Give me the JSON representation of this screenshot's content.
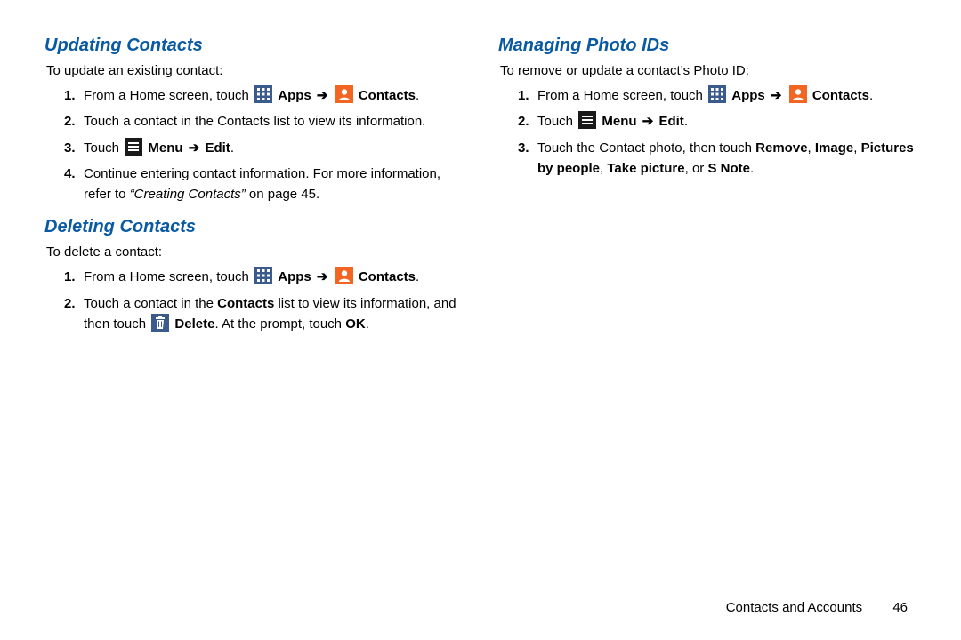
{
  "icons": {
    "arrow_glyph": "➔"
  },
  "left": {
    "sectionA": {
      "title": "Updating Contacts",
      "intro": "To update an existing contact:",
      "steps": {
        "s1": {
          "pre": "From a Home screen, touch ",
          "apps": "Apps",
          "contacts": "Contacts",
          "post": "."
        },
        "s2": "Touch a contact in the Contacts list to view its information.",
        "s3": {
          "pre": "Touch ",
          "menu": "Menu",
          "edit": "Edit",
          "post": "."
        },
        "s4": {
          "pre": "Continue entering contact information. For more information, refer to ",
          "ref": "“Creating Contacts”",
          "post": " on page 45."
        }
      }
    },
    "sectionB": {
      "title": "Deleting Contacts",
      "intro": "To delete a contact:",
      "steps": {
        "s1": {
          "pre": "From a Home screen, touch ",
          "apps": "Apps",
          "contacts": "Contacts",
          "post": "."
        },
        "s2": {
          "pre": "Touch a contact in the ",
          "contacts_list": "Contacts",
          "mid": " list to view its information, and then touch ",
          "delete": "Delete",
          "post1": ". At the prompt, touch ",
          "ok": "OK",
          "post2": "."
        }
      }
    }
  },
  "right": {
    "sectionC": {
      "title": "Managing Photo IDs",
      "intro": "To remove or update a contact’s Photo ID:",
      "steps": {
        "s1": {
          "pre": "From a Home screen, touch ",
          "apps": "Apps",
          "contacts": "Contacts",
          "post": "."
        },
        "s2": {
          "pre": "Touch ",
          "menu": "Menu",
          "edit": "Edit",
          "post": "."
        },
        "s3": {
          "pre": "Touch the Contact photo, then touch ",
          "remove": "Remove",
          "c1": ", ",
          "image": "Image",
          "c2": ", ",
          "pbp": "Pictures by people",
          "c3": ", ",
          "take": "Take picture",
          "c4": ", or ",
          "snote": "S Note",
          "post": "."
        }
      }
    }
  },
  "footer": {
    "section": "Contacts and Accounts",
    "page": "46"
  }
}
